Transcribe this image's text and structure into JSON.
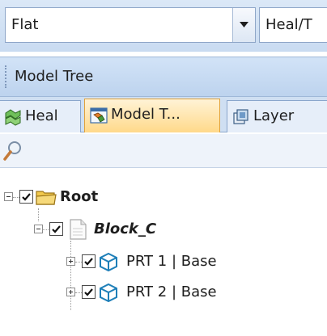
{
  "toolbar": {
    "view_mode_value": "Flat",
    "heal_combo_value": "Heal/T"
  },
  "panel": {
    "caption": "Model Tree"
  },
  "tabs": [
    {
      "label": "Heal",
      "icon": "heal-icon",
      "active": false
    },
    {
      "label": "Model T...",
      "icon": "model-tree-icon",
      "active": true
    },
    {
      "label": "Layer",
      "icon": "layer-icon",
      "active": false
    }
  ],
  "search": {
    "icon": "search-icon"
  },
  "tree": {
    "root": {
      "label": "Root",
      "checked": true,
      "expanded": true,
      "icon": "folder-icon"
    },
    "block": {
      "label": "Block_C",
      "checked": true,
      "expanded": true,
      "icon": "document-icon"
    },
    "parts": [
      {
        "label": "PRT 1 | Base",
        "checked": true,
        "expanded": false,
        "icon": "part-cube-icon"
      },
      {
        "label": "PRT 2 | Base",
        "checked": true,
        "expanded": false,
        "icon": "part-cube-icon"
      }
    ]
  },
  "colors": {
    "toolbar_bg": "#d4e4f6",
    "active_tab": "#ffd98a",
    "cube_outline": "#1e7fb8"
  }
}
